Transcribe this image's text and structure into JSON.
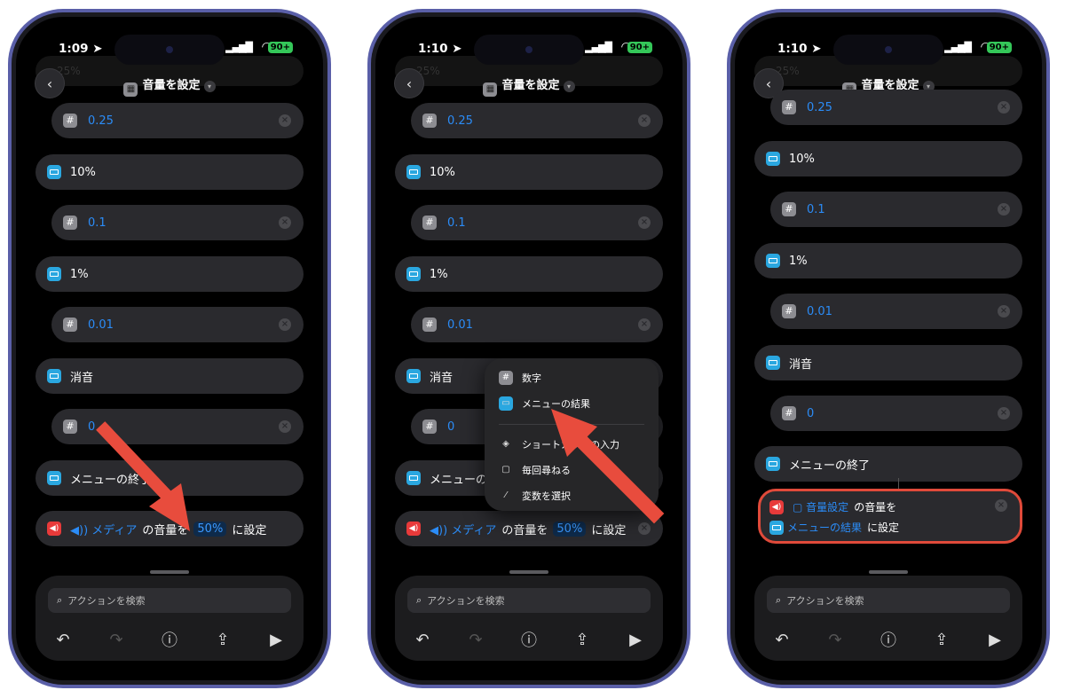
{
  "status": {
    "times": [
      "1:09",
      "1:10",
      "1:10"
    ],
    "location_icon": "location-arrow-icon",
    "battery": "90+"
  },
  "nav": {
    "title": "音量を設定"
  },
  "ghost_text": "25%",
  "rows": {
    "v025": "0.25",
    "l10": "10%",
    "v01": "0.1",
    "l1": "1%",
    "v001": "0.01",
    "mute": "消音",
    "v0": "0",
    "end": "メニューの終了"
  },
  "action": {
    "media_label": "メディア",
    "middle": "の音量を",
    "amount": "50%",
    "suffix": "に設定"
  },
  "popup": {
    "number": "数字",
    "menu_result": "メニューの結果",
    "shortcut_input": "ショートカットの入力",
    "ask_each_time": "毎回尋ねる",
    "select_variable": "変数を選択"
  },
  "result_action": {
    "volume_setting": "音量設定",
    "middle": "の音量を",
    "menu_result": "メニューの結果",
    "suffix": "に設定"
  },
  "bottom": {
    "search_placeholder": "アクションを検索"
  },
  "colors": {
    "accent": "#2b8cf7",
    "arrow": "#e84c3d",
    "menu_icon": "#2aa7e0",
    "volume_icon": "#e83a3a",
    "phone_frame": "#5a5fa8"
  }
}
